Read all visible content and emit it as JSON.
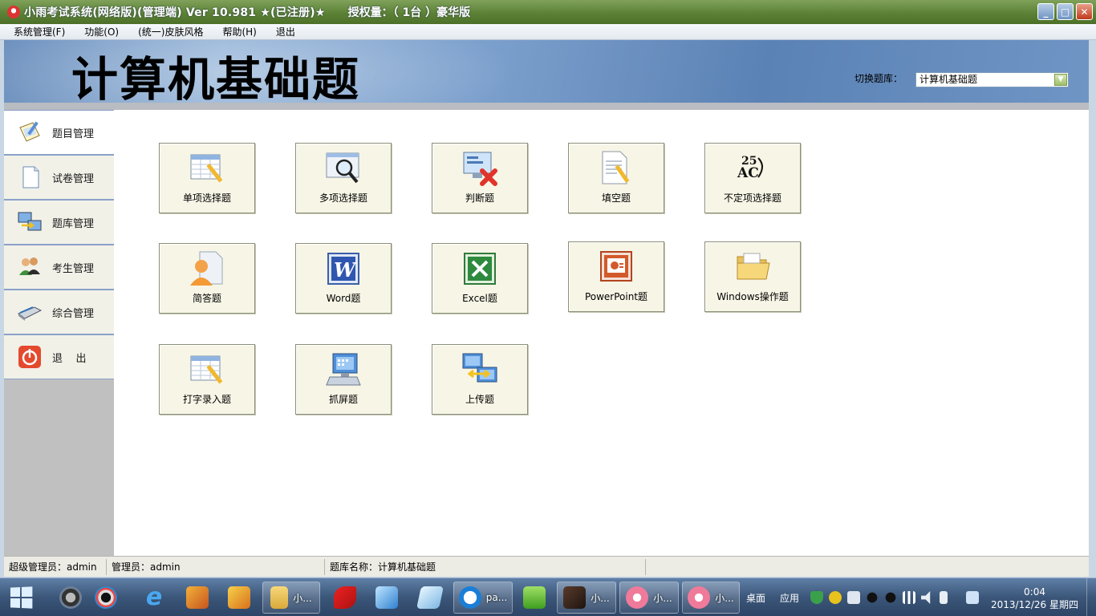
{
  "window": {
    "title": "小雨考试系统(网络版)(管理端) Ver 10.981 ★(已注册)★",
    "license": "授权量：（ 1台 ）豪华版",
    "buttons": {
      "minimize": "_",
      "maximize": "□",
      "close": "✕"
    }
  },
  "menu": [
    {
      "label": "系统管理(F)"
    },
    {
      "label": "功能(O)"
    },
    {
      "label": "(统一)皮肤风格"
    },
    {
      "label": "帮助(H)"
    },
    {
      "label": "退出"
    }
  ],
  "header": {
    "bank_title": "计算机基础题",
    "switch_label": "切换题库：",
    "selected_bank": "计算机基础题"
  },
  "sidebar": {
    "items": [
      {
        "label": "题目管理",
        "icon": "pencil-paper-icon",
        "active": true
      },
      {
        "label": "试卷管理",
        "icon": "blank-document-icon",
        "active": false
      },
      {
        "label": "题库管理",
        "icon": "transfer-computers-icon",
        "active": false
      },
      {
        "label": "考生管理",
        "icon": "users-icon",
        "active": false
      },
      {
        "label": "综合管理",
        "icon": "scanner-icon",
        "active": false
      },
      {
        "label": "退    出",
        "icon": "power-icon",
        "active": false
      }
    ]
  },
  "tiles": [
    {
      "label": "单项选择题",
      "icon": "form-pencil-icon"
    },
    {
      "label": "多项选择题",
      "icon": "magnifier-window-icon"
    },
    {
      "label": "判断题",
      "icon": "monitor-cross-icon"
    },
    {
      "label": "填空题",
      "icon": "document-pencil-icon"
    },
    {
      "label": "不定项选择题",
      "icon": "abc-sort-icon"
    },
    {
      "label": "简答题",
      "icon": "person-document-icon"
    },
    {
      "label": "Word题",
      "icon": "word-icon"
    },
    {
      "label": "Excel题",
      "icon": "excel-icon"
    },
    {
      "label": "PowerPoint题",
      "icon": "powerpoint-icon"
    },
    {
      "label": "Windows操作题",
      "icon": "folder-icon"
    },
    {
      "label": "打字录入题",
      "icon": "typing-form-icon"
    },
    {
      "label": "抓屏题",
      "icon": "screen-capture-icon"
    },
    {
      "label": "上传题",
      "icon": "upload-computers-icon"
    }
  ],
  "status": {
    "super_admin": "超级管理员：admin",
    "admin": "管理员：admin",
    "bank_name": "题库名称：计算机基础题"
  },
  "taskbar": {
    "apps": [
      {
        "label": "",
        "icon": "sogou-icon"
      },
      {
        "label": "",
        "icon": "camera-icon"
      },
      {
        "label": "",
        "icon": "ie-icon"
      },
      {
        "label": "",
        "icon": "package-icon"
      },
      {
        "label": "",
        "icon": "tools-icon"
      },
      {
        "label": "小...",
        "icon": "folder-icon"
      },
      {
        "label": "",
        "icon": "swiss-knife-icon"
      },
      {
        "label": "",
        "icon": "cube-icon"
      },
      {
        "label": "",
        "icon": "notebook-icon"
      },
      {
        "label": "pa...",
        "icon": "browser-e-icon"
      },
      {
        "label": "",
        "icon": "hao123-icon"
      },
      {
        "label": "小...",
        "icon": "photo-icon"
      },
      {
        "label": "小...",
        "icon": "xiaoyu-icon"
      },
      {
        "label": "小...",
        "icon": "xiaoyu-icon"
      }
    ],
    "desktop_label": "桌面",
    "app_label": "应用",
    "time": "0:04",
    "date": "2013/12/26 星期四"
  },
  "colors": {
    "titlebar": "#5c8236",
    "banner": "#7b9fcc",
    "tile_bg": "#f7f5e6",
    "taskbar": "#3b5679"
  }
}
